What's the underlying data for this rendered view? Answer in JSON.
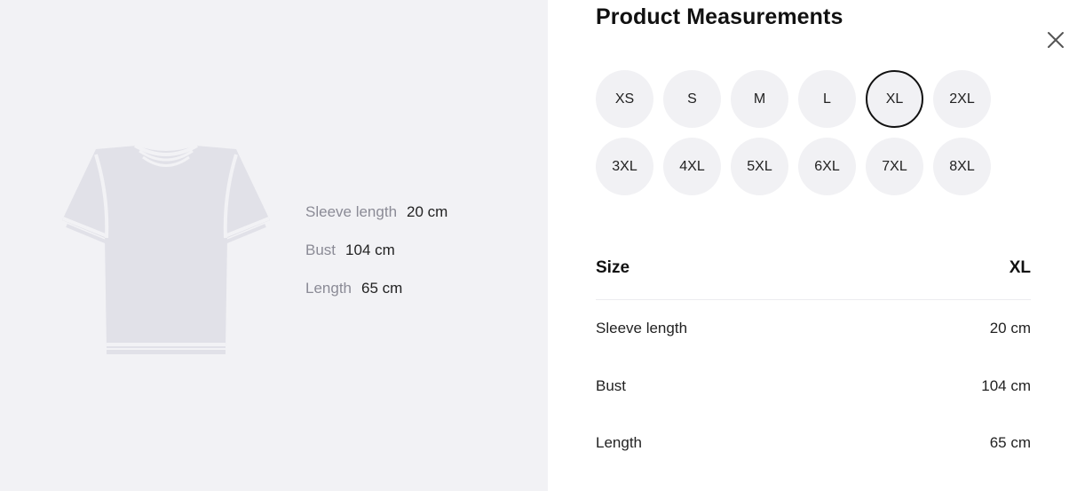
{
  "left": {
    "image_icon": "t-shirt-outline",
    "measurements": [
      {
        "label": "Sleeve length",
        "value": "20 cm"
      },
      {
        "label": "Bust",
        "value": "104 cm"
      },
      {
        "label": "Length",
        "value": "65 cm"
      }
    ]
  },
  "right": {
    "title": "Product Measurements",
    "close_icon": "close-icon",
    "sizes": [
      "XS",
      "S",
      "M",
      "L",
      "XL",
      "2XL",
      "3XL",
      "4XL",
      "5XL",
      "6XL",
      "7XL",
      "8XL"
    ],
    "selected_size": "XL",
    "table": {
      "header_label": "Size",
      "header_value": "XL",
      "rows": [
        {
          "label": "Sleeve length",
          "value": "20 cm"
        },
        {
          "label": "Bust",
          "value": "104 cm"
        },
        {
          "label": "Length",
          "value": "65 cm"
        }
      ]
    }
  },
  "colors": {
    "panel_bg": "#f2f2f5",
    "chip_bg": "#f1f1f4",
    "selected_border": "#111111",
    "muted_text": "#8b8b96"
  }
}
